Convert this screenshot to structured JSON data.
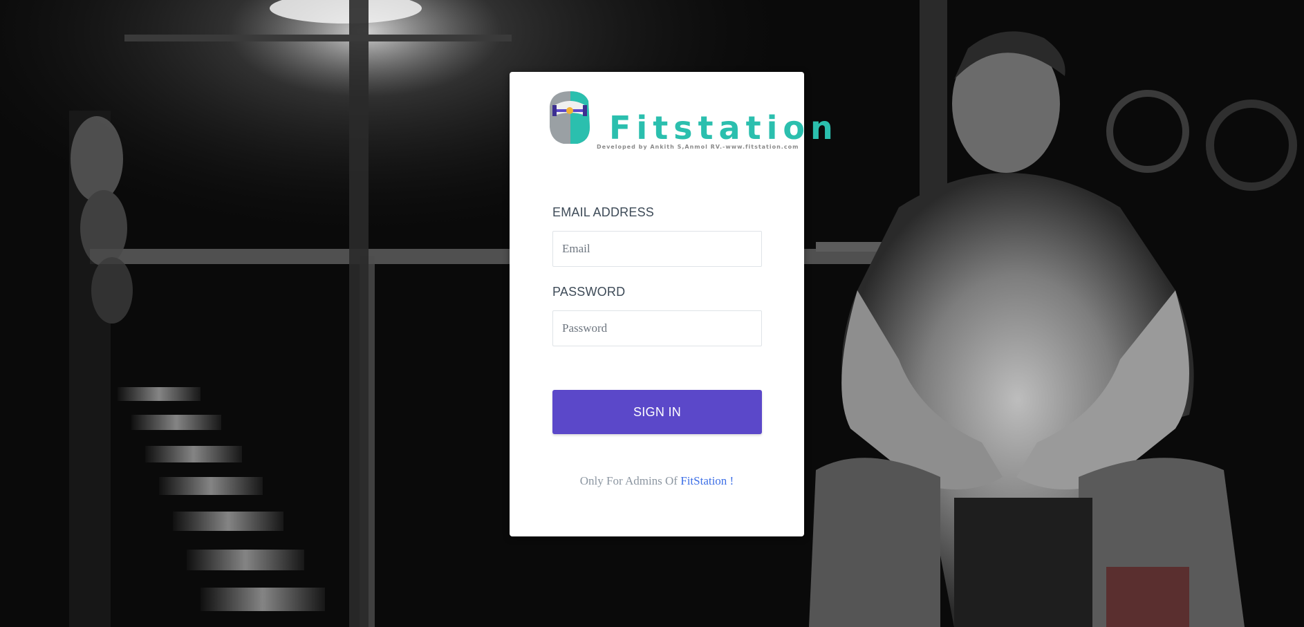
{
  "colors": {
    "accent": "#5b48c9",
    "link": "#3d6fe6",
    "logo_teal": "#2bbfae",
    "label_text": "#3d4a57"
  },
  "background": {
    "description_icon": "gym-photo"
  },
  "logo": {
    "word": "Fitstation",
    "tagline": "Developed by Ankith S,Anmol RV.-www.fitstation.com",
    "icon": "dumbbell-head-icon"
  },
  "form": {
    "email_label": "EMAIL ADDRESS",
    "email_placeholder": "Email",
    "password_label": "PASSWORD",
    "password_placeholder": "Password",
    "submit_label": "SIGN IN"
  },
  "footer": {
    "prefix": "Only For Admins Of ",
    "link_text": "FitStation !"
  }
}
